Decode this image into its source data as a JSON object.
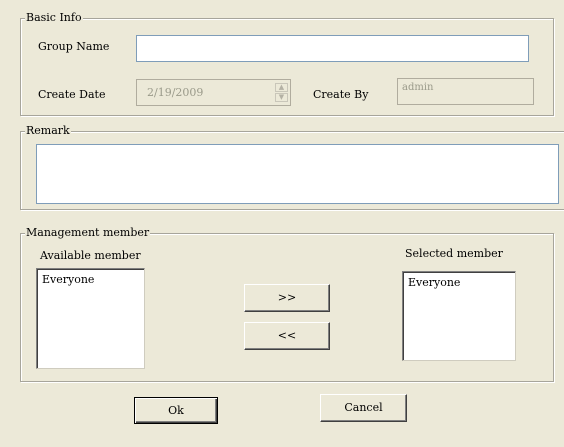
{
  "basic_info": {
    "legend": "Basic Info",
    "group_name_label": "Group Name",
    "group_name_value": "",
    "create_date_label": "Create Date",
    "create_date_value": "2/19/2009",
    "create_by_label": "Create By",
    "create_by_value": "admin"
  },
  "remark": {
    "legend": "Remark",
    "value": ""
  },
  "management": {
    "legend": "Management member",
    "available_label": "Available member",
    "available_items": [
      "Everyone"
    ],
    "selected_label": "Selected member",
    "selected_items": [
      "Everyone"
    ],
    "add_button": ">>",
    "remove_button": "<<"
  },
  "buttons": {
    "ok": "Ok",
    "cancel": "Cancel"
  }
}
